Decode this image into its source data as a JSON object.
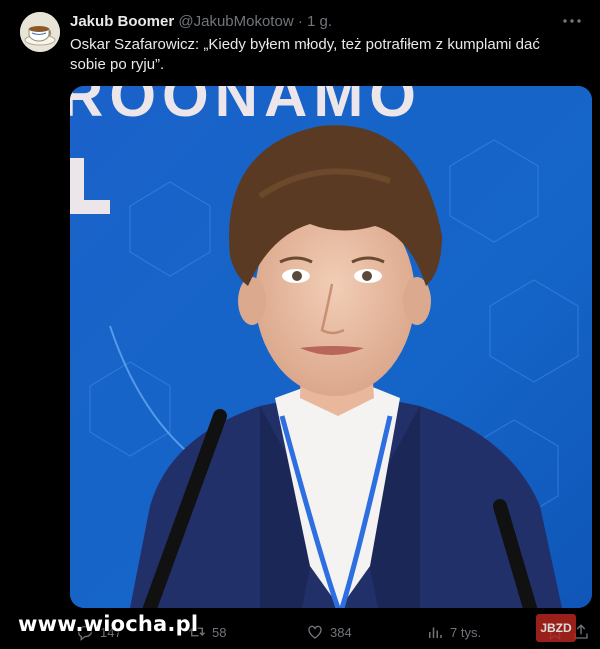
{
  "author": {
    "name": "Jakub Boomer",
    "handle": "@JakubMokotow",
    "separator": "·",
    "time": "1 g."
  },
  "tweet": {
    "text": "Oskar Szafarowicz: „Kiedy byłem młody, też potrafiłem z kumplami dać sobie po ryju”."
  },
  "media": {
    "backdrop_text": "RODNAMO L"
  },
  "actions": {
    "replies": "147",
    "retweets": "58",
    "likes": "384",
    "views": "7 tys."
  },
  "overlay": {
    "watermark": "www.wiocha.pl",
    "badge": "JBZD"
  },
  "icons": {
    "more": "more-icon",
    "reply": "reply-icon",
    "retweet": "retweet-icon",
    "like": "heart-icon",
    "views": "views-icon",
    "bookmark": "bookmark-icon",
    "share": "share-icon"
  },
  "colors": {
    "background": "#000000",
    "text": "#e7e9ea",
    "muted": "#71767b",
    "studio_blue": "#1565c8",
    "jacket": "#22306a"
  }
}
